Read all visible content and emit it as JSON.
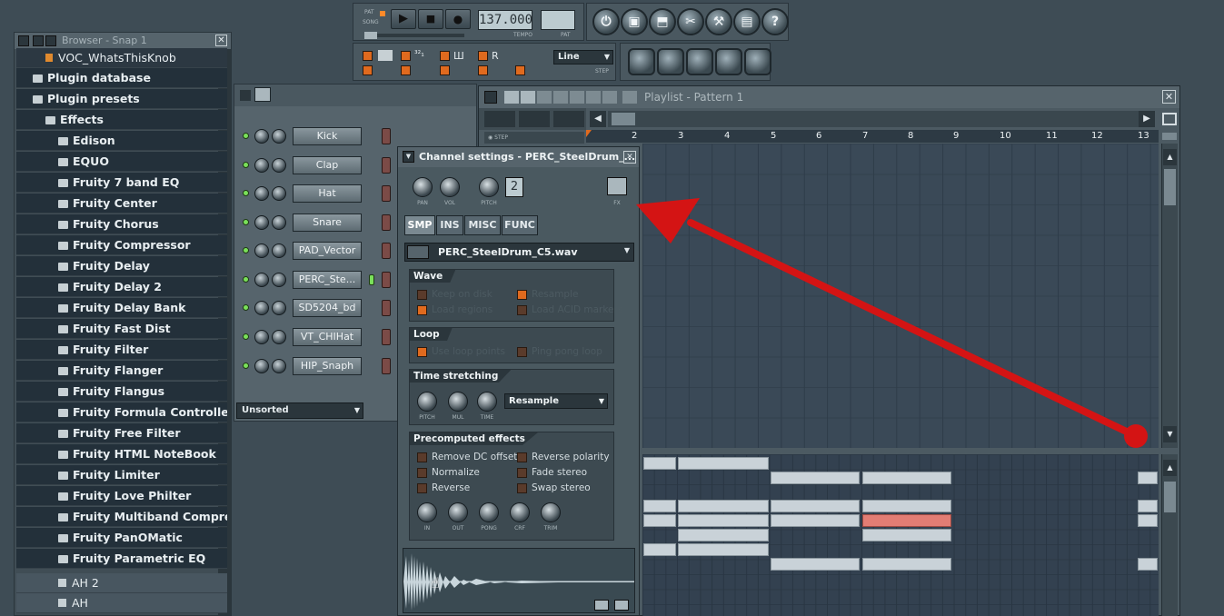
{
  "transport": {
    "pat_label": "PAT",
    "song_label": "SONG",
    "tempo_value": "137.000",
    "tempo_label": "TEMPO",
    "pattern_label": "PAT",
    "snap_value": "Line",
    "step_label": "STEP"
  },
  "browser": {
    "title": "Browser - Snap 1",
    "items": [
      {
        "label": "VOC_WhatsThisKnob"
      },
      {
        "label": "Plugin database"
      },
      {
        "label": "Plugin presets"
      },
      {
        "label": "Effects"
      },
      {
        "label": "Edison"
      },
      {
        "label": "EQUO"
      },
      {
        "label": "Fruity 7 band EQ"
      },
      {
        "label": "Fruity Center"
      },
      {
        "label": "Fruity Chorus"
      },
      {
        "label": "Fruity Compressor"
      },
      {
        "label": "Fruity Delay"
      },
      {
        "label": "Fruity Delay 2"
      },
      {
        "label": "Fruity Delay Bank"
      },
      {
        "label": "Fruity Fast Dist"
      },
      {
        "label": "Fruity Filter"
      },
      {
        "label": "Fruity Flanger"
      },
      {
        "label": "Fruity Flangus"
      },
      {
        "label": "Fruity Formula Controller"
      },
      {
        "label": "Fruity Free Filter"
      },
      {
        "label": "Fruity HTML NoteBook"
      },
      {
        "label": "Fruity Limiter"
      },
      {
        "label": "Fruity Love Philter"
      },
      {
        "label": "Fruity Multiband Compressor"
      },
      {
        "label": "Fruity PanOMatic"
      },
      {
        "label": "Fruity Parametric EQ"
      },
      {
        "label": "AH 2"
      },
      {
        "label": "AH"
      }
    ]
  },
  "step_sequencer": {
    "channels": [
      {
        "name": "Kick"
      },
      {
        "name": "Clap"
      },
      {
        "name": "Hat"
      },
      {
        "name": "Snare"
      },
      {
        "name": "PAD_Vector"
      },
      {
        "name": "PERC_Ste..."
      },
      {
        "name": "SD5204_bd"
      },
      {
        "name": "VT_CHIHat"
      },
      {
        "name": "HIP_Snaph"
      }
    ],
    "filter": "Unsorted"
  },
  "channel_settings": {
    "title": "Channel settings - PERC_SteelDrum_...",
    "knobs": {
      "pan": "PAN",
      "vol": "VOL",
      "pitch": "PITCH",
      "fx": "FX"
    },
    "fx_value": "2",
    "tabs": [
      "SMP",
      "INS",
      "MISC",
      "FUNC"
    ],
    "sample_file": "PERC_SteelDrum_C5.wav",
    "wave": {
      "title": "Wave",
      "options": [
        "Keep on disk",
        "Resample",
        "Load regions",
        "Load ACID markers"
      ]
    },
    "loop": {
      "title": "Loop",
      "options": [
        "Use loop points",
        "Ping pong loop"
      ]
    },
    "time_stretching": {
      "title": "Time stretching",
      "mode": "Resample",
      "knobs": [
        "PITCH",
        "MUL",
        "TIME"
      ]
    },
    "precomputed": {
      "title": "Precomputed effects",
      "options": [
        "Remove DC offset",
        "Reverse polarity",
        "Normalize",
        "Fade stereo",
        "Reverse",
        "Swap stereo"
      ],
      "knobs": [
        "IN",
        "OUT",
        "PONG",
        "CRF",
        "TRIM"
      ]
    }
  },
  "playlist": {
    "title": "Playlist - Pattern 1",
    "step_label": "STEP",
    "ruler": [
      "2",
      "3",
      "4",
      "5",
      "6",
      "7",
      "8",
      "9",
      "10",
      "11",
      "12",
      "13"
    ]
  },
  "colors": {
    "accent": "#e06a1e",
    "arrow": "#d41414",
    "pattern_block": "#c9d2d8",
    "selected_block": "#e27d74"
  }
}
